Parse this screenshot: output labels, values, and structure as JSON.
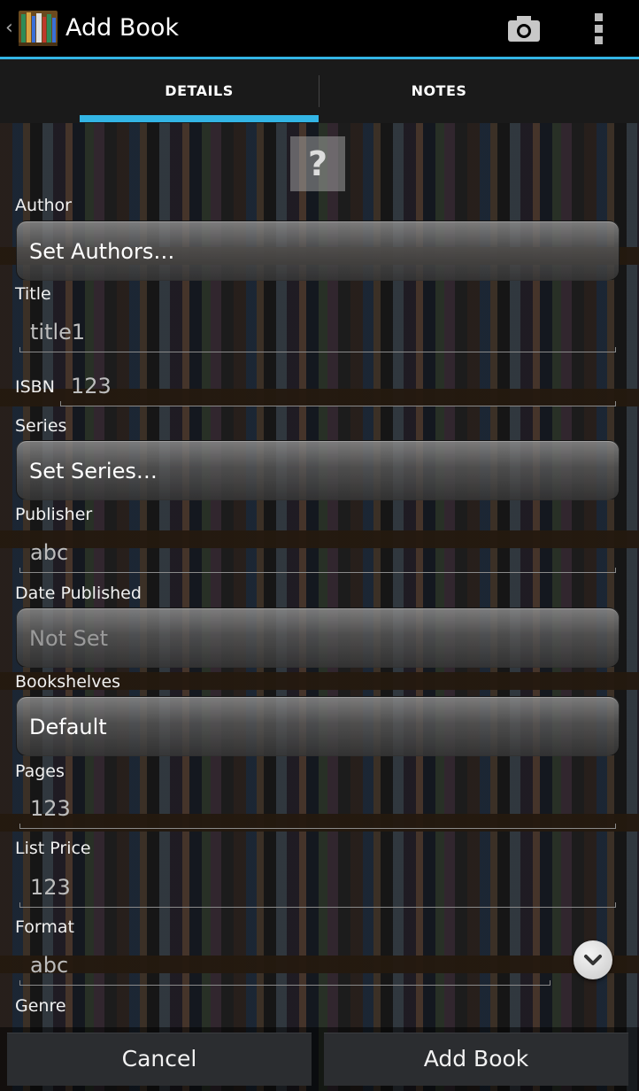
{
  "actionbar": {
    "title": "Add Book",
    "up_icon": "chevron-left-icon",
    "logo_icon": "bookshelf-logo-icon",
    "camera_icon": "camera-icon",
    "overflow_icon": "overflow-menu-icon"
  },
  "tabs": [
    {
      "label": "DETAILS",
      "selected": true
    },
    {
      "label": "NOTES",
      "selected": false
    }
  ],
  "colors": {
    "accent": "#33b5e5"
  },
  "cover_placeholder": "?",
  "fields": {
    "author": {
      "label": "Author",
      "value": "Set Authors…"
    },
    "title": {
      "label": "Title",
      "value": "title1"
    },
    "isbn": {
      "label": "ISBN",
      "value": "123"
    },
    "series": {
      "label": "Series",
      "value": "Set Series…"
    },
    "publisher": {
      "label": "Publisher",
      "value": "abc"
    },
    "date_published": {
      "label": "Date Published",
      "value": "Not Set"
    },
    "bookshelves": {
      "label": "Bookshelves",
      "value": "Default"
    },
    "pages": {
      "label": "Pages",
      "value": "123"
    },
    "list_price": {
      "label": "List Price",
      "value": "123"
    },
    "format": {
      "label": "Format",
      "value": "abc"
    },
    "genre": {
      "label": "Genre"
    }
  },
  "buttons": {
    "cancel": "Cancel",
    "add_book": "Add Book"
  }
}
